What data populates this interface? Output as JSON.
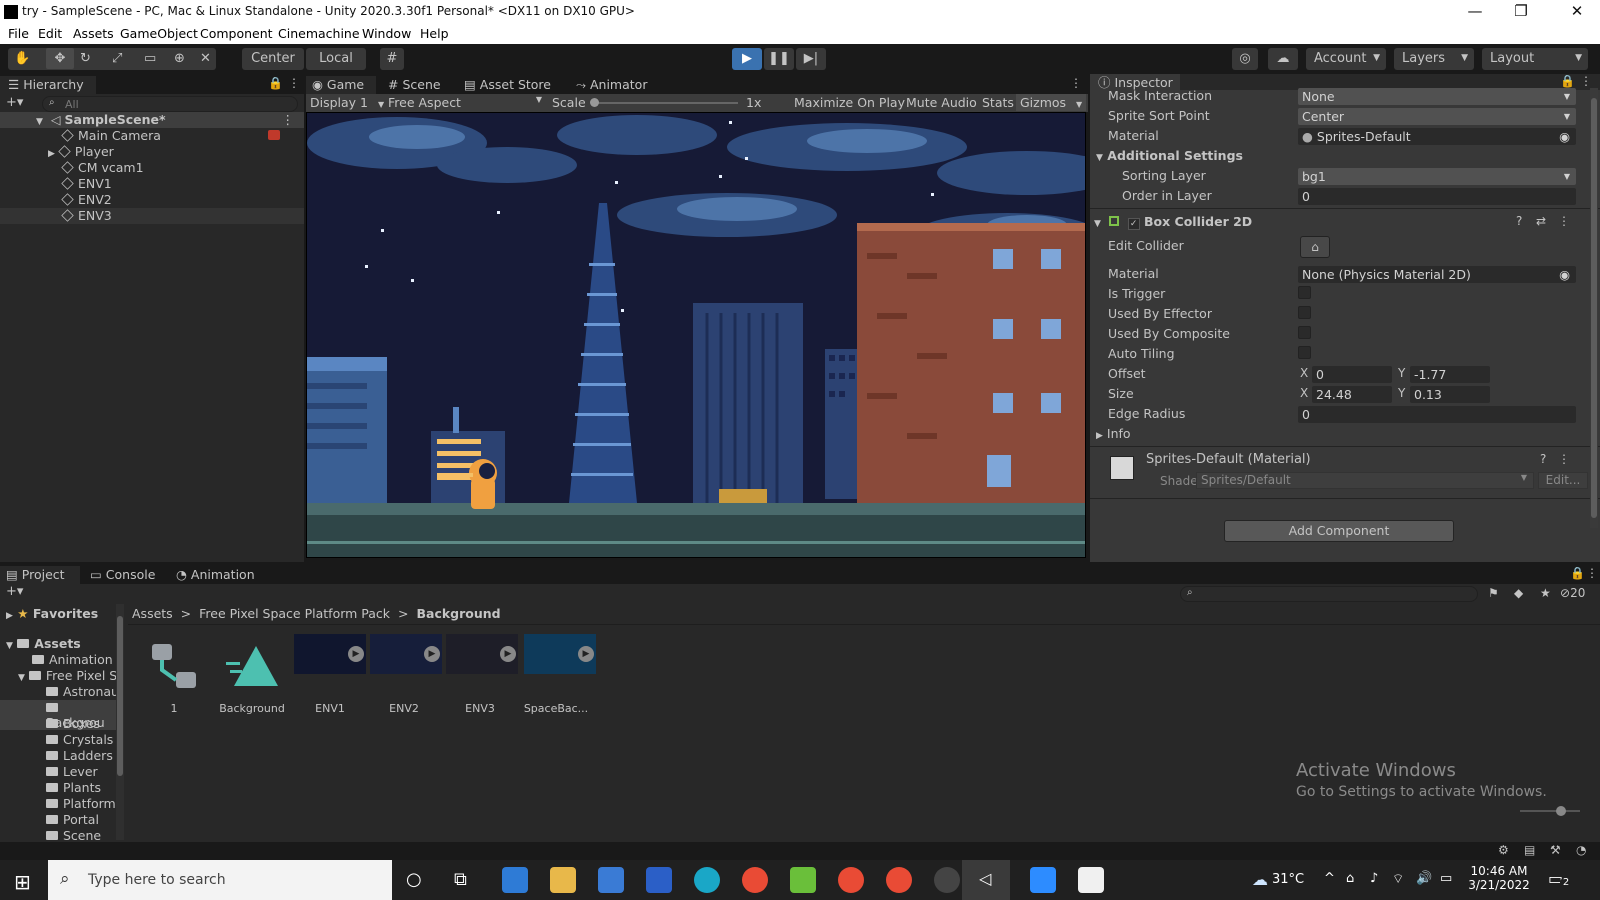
{
  "window": {
    "title": "try - SampleScene - PC, Mac & Linux Standalone - Unity 2020.3.30f1 Personal* <DX11 on DX10 GPU>",
    "minimize": "—",
    "maximize": "❐",
    "close": "✕"
  },
  "menu": [
    "File",
    "Edit",
    "Assets",
    "GameObject",
    "Component",
    "Cinemachine",
    "Window",
    "Help"
  ],
  "toolbar": {
    "pivot_label": "Center",
    "space_label": "Local",
    "account_label": "Account",
    "layers_label": "Layers",
    "layout_label": "Layout"
  },
  "hierarchy": {
    "tab": "Hierarchy",
    "search_placeholder": "All",
    "scene": "SampleScene*",
    "items": [
      "Main Camera",
      "Player",
      "CM vcam1",
      "ENV1",
      "ENV2",
      "ENV3"
    ]
  },
  "game_view": {
    "tabs": [
      "Game",
      "Scene",
      "Asset Store",
      "Animator"
    ],
    "display": "Display 1",
    "aspect": "Free Aspect",
    "scale_label": "Scale",
    "scale_value": "1x",
    "maximize": "Maximize On Play",
    "mute": "Mute Audio",
    "stats": "Stats",
    "gizmos": "Gizmos"
  },
  "inspector": {
    "tab": "Inspector",
    "mask_interaction": {
      "label": "Mask Interaction",
      "value": "None"
    },
    "sprite_sort_point": {
      "label": "Sprite Sort Point",
      "value": "Center"
    },
    "material": {
      "label": "Material",
      "value": "Sprites-Default"
    },
    "additional_settings": "Additional Settings",
    "sorting_layer": {
      "label": "Sorting Layer",
      "value": "bg1"
    },
    "order_in_layer": {
      "label": "Order in Layer",
      "value": "0"
    },
    "box_collider": "Box Collider 2D",
    "edit_collider": "Edit Collider",
    "bc_material": {
      "label": "Material",
      "value": "None (Physics Material 2D)"
    },
    "is_trigger": "Is Trigger",
    "used_by_effector": "Used By Effector",
    "used_by_composite": "Used By Composite",
    "auto_tiling": "Auto Tiling",
    "offset": {
      "label": "Offset",
      "x_label": "X",
      "x": "0",
      "y_label": "Y",
      "y": "-1.77"
    },
    "size": {
      "label": "Size",
      "x_label": "X",
      "x": "24.48",
      "y_label": "Y",
      "y": "0.13"
    },
    "edge_radius": {
      "label": "Edge Radius",
      "value": "0"
    },
    "info": "Info",
    "material_asset": "Sprites-Default (Material)",
    "shader_label": "Shader",
    "shader_value": "Sprites/Default",
    "edit_btn": "Edit...",
    "add_component": "Add Component"
  },
  "project": {
    "tabs": [
      "Project",
      "Console",
      "Animation"
    ],
    "favorites": "Favorites",
    "assets_root": "Assets",
    "tree": [
      "Animation",
      "Free Pixel S",
      "Astronaut",
      "Backgrou",
      "Boxes",
      "Crystals",
      "Ladders",
      "Lever",
      "Plants",
      "Platforms",
      "Portal",
      "Scene"
    ],
    "breadcrumb": [
      "Assets",
      "Free Pixel Space Platform Pack",
      "Background"
    ],
    "assets": [
      "1",
      "Background",
      "ENV1",
      "ENV2",
      "ENV3",
      "SpaceBac..."
    ],
    "hidden_count": "20"
  },
  "watermark": {
    "title": "Activate Windows",
    "subtitle": "Go to Settings to activate Windows."
  },
  "taskbar": {
    "search_placeholder": "Type here to search",
    "weather": "31°C",
    "time": "10:46 AM",
    "date": "3/21/2022",
    "notifications": "2"
  }
}
